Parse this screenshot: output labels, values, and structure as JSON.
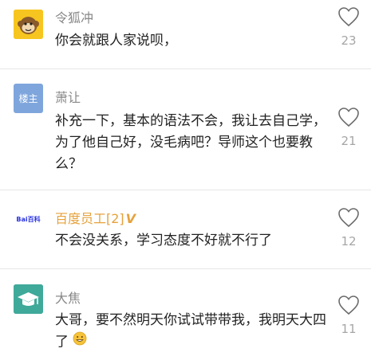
{
  "comments": [
    {
      "user": "令狐冲",
      "text": "你会就跟人家说呗，",
      "likes": "23"
    },
    {
      "user": "萧让",
      "avatar_text": "楼主",
      "text": "补充一下，基本的语法不会，我让去自己学，为了他自己好，没毛病吧？导师这个也要教么？",
      "likes": "21"
    },
    {
      "user": "百度员工[2]",
      "badge": "V",
      "avatar_text": "Bai百科",
      "text": "不会没关系，学习态度不好就不行了",
      "likes": "12"
    },
    {
      "user": "大焦",
      "text": "大哥，要不然明天你试试带带我，我明天大四了",
      "likes": "11"
    }
  ],
  "colors": {
    "accent_orange": "#e6a23c",
    "avatar_blue": "#7fa6dc",
    "avatar_teal": "#3fa99a",
    "avatar_yellow": "#f7c51f"
  }
}
